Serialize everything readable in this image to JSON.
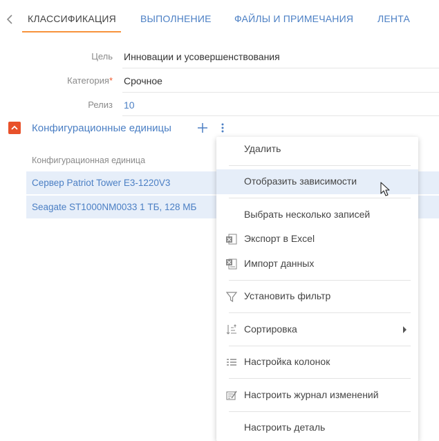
{
  "tabs": [
    {
      "label": "КЛАССИФИКАЦИЯ"
    },
    {
      "label": "ВЫПОЛНЕНИЕ"
    },
    {
      "label": "ФАЙЛЫ И ПРИМЕЧАНИЯ"
    },
    {
      "label": "ЛЕНТА"
    }
  ],
  "fields": {
    "goal": {
      "label": "Цель",
      "value": "Инновации и усовершенствования"
    },
    "category": {
      "label": "Категория",
      "required_mark": "*",
      "value": "Срочное"
    },
    "release": {
      "label": "Релиз",
      "value": "10"
    }
  },
  "detail": {
    "title": "Конфигурационные единицы",
    "column_header": "Конфигурационная единица",
    "rows": [
      {
        "name": "Сервер Patriot Tower E3-1220V3"
      },
      {
        "name": "Seagate ST1000NM0033 1 ТБ, 128 МБ"
      }
    ]
  },
  "menu": {
    "items": [
      {
        "label": "Удалить",
        "icon": ""
      },
      {
        "label": "Отобразить зависимости",
        "icon": "",
        "hover": true
      },
      {
        "label": "Выбрать несколько записей",
        "icon": ""
      },
      {
        "label": "Экспорт в Excel",
        "icon": "excel-export-icon"
      },
      {
        "label": "Импорт данных",
        "icon": "import-data-icon"
      },
      {
        "label": "Установить фильтр",
        "icon": "filter-icon"
      },
      {
        "label": "Сортировка",
        "icon": "sort-icon",
        "submenu": true
      },
      {
        "label": "Настройка колонок",
        "icon": "columns-icon"
      },
      {
        "label": "Настроить журнал изменений",
        "icon": "change-log-icon"
      },
      {
        "label": "Настроить деталь",
        "icon": ""
      }
    ]
  },
  "colors": {
    "accent_link": "#4b7fc4",
    "tab_underline": "#f7923a",
    "collapse_button": "#e8512a",
    "selection": "#e6eef9"
  }
}
